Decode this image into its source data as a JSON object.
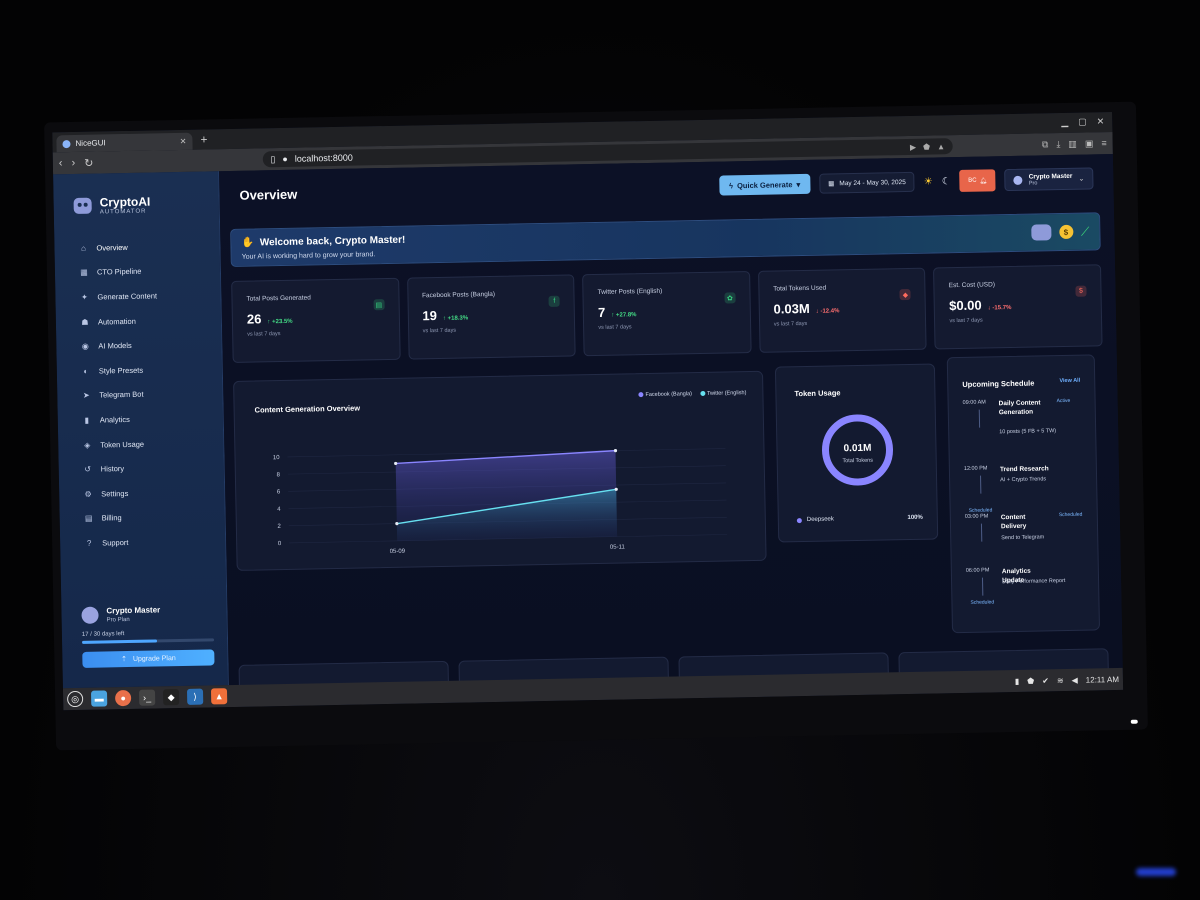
{
  "browser": {
    "tab_title": "NiceGUI",
    "url": "localhost:8000"
  },
  "sidebar": {
    "brand_name": "CryptoAI",
    "brand_sub": "AUTOMATOR",
    "items": [
      {
        "label": "Overview",
        "icon": "home-icon",
        "glyph": "⌂"
      },
      {
        "label": "CTO Pipeline",
        "icon": "pipeline-icon",
        "glyph": "▦"
      },
      {
        "label": "Generate Content",
        "icon": "sparkle-icon",
        "glyph": "✦"
      },
      {
        "label": "Automation",
        "icon": "robot-icon",
        "glyph": "☗"
      },
      {
        "label": "AI Models",
        "icon": "brain-icon",
        "glyph": "◉"
      },
      {
        "label": "Style Presets",
        "icon": "palette-icon",
        "glyph": "◐"
      },
      {
        "label": "Telegram Bot",
        "icon": "send-icon",
        "glyph": "➤"
      },
      {
        "label": "Analytics",
        "icon": "bar-chart-icon",
        "glyph": "▮"
      },
      {
        "label": "Token Usage",
        "icon": "token-icon",
        "glyph": "◈"
      },
      {
        "label": "History",
        "icon": "history-icon",
        "glyph": "↺"
      },
      {
        "label": "Settings",
        "icon": "gear-icon",
        "glyph": "⚙"
      },
      {
        "label": "Billing",
        "icon": "billing-icon",
        "glyph": "▤"
      },
      {
        "label": "Support",
        "icon": "help-icon",
        "glyph": "?"
      }
    ],
    "user": {
      "name": "Crypto Master",
      "plan": "Pro Plan",
      "days_left": "17 / 30 days left",
      "days_progress": 0.57,
      "upgrade_label": "Upgrade Plan"
    }
  },
  "header": {
    "title": "Overview",
    "quick_generate": "Quick Generate",
    "date_range": "May 24 - May 30, 2025",
    "notif_badge": "BC",
    "profile_name": "Crypto Master",
    "profile_plan": "Pro"
  },
  "welcome": {
    "title": "Welcome back, Crypto Master!",
    "subtitle": "Your AI is working hard to grow your brand."
  },
  "stats": [
    {
      "label": "Total Posts Generated",
      "value": "26",
      "change": "↑ +23.5%",
      "dir": "up",
      "sub": "vs last 7 days",
      "icon": "document-icon",
      "glyph": "▤",
      "color": "#35d07f"
    },
    {
      "label": "Facebook Posts (Bangla)",
      "value": "19",
      "change": "↑ +18.3%",
      "dir": "up",
      "sub": "vs last 7 days",
      "icon": "facebook-icon",
      "glyph": "f",
      "color": "#35d07f"
    },
    {
      "label": "Twitter Posts (English)",
      "value": "7",
      "change": "↑ +27.8%",
      "dir": "up",
      "sub": "vs last 7 days",
      "icon": "twitter-icon",
      "glyph": "✿",
      "color": "#35d07f"
    },
    {
      "label": "Total Tokens Used",
      "value": "0.03M",
      "change": "↓ -12.4%",
      "dir": "down",
      "sub": "vs last 7 days",
      "icon": "layers-icon",
      "glyph": "◆",
      "color": "#ff6b5e"
    },
    {
      "label": "Est. Cost (USD)",
      "value": "$0.00",
      "change": "↓ -15.7%",
      "dir": "down",
      "sub": "vs last 7 days",
      "icon": "dollar-icon",
      "glyph": "$",
      "color": "#ff6b5e"
    }
  ],
  "chart_data": {
    "type": "area",
    "title": "Content Generation Overview",
    "x": [
      "05-09",
      "05-11"
    ],
    "ylim": [
      0,
      10
    ],
    "yticks": [
      0,
      2,
      4,
      6,
      8,
      10
    ],
    "series": [
      {
        "name": "Facebook (Bangla)",
        "values": [
          9,
          10
        ],
        "color": "#8a85ff"
      },
      {
        "name": "Twitter (English)",
        "values": [
          2,
          5.5
        ],
        "color": "#67e0f0"
      }
    ],
    "legend": "top-right",
    "grid": true
  },
  "token_usage": {
    "title": "Token Usage",
    "total_value": "0.01M",
    "total_label": "Total Tokens",
    "model": "Deepseek",
    "model_share": 1.0,
    "model_pct": "100%",
    "ring_color": "#8a85ff"
  },
  "schedule": {
    "title": "Upcoming Schedule",
    "view_all": "View All",
    "items": [
      {
        "time": "09:00 AM",
        "title": "Daily Content Generation",
        "desc": "10 posts (5 FB + 5 TW)",
        "status": "Active"
      },
      {
        "time": "12:00 PM",
        "title": "Trend Research",
        "desc": "AI + Crypto Trends",
        "status": "Scheduled"
      },
      {
        "time": "03:00 PM",
        "title": "Content Delivery",
        "desc": "Send to Telegram",
        "status": "Scheduled"
      },
      {
        "time": "06:00 PM",
        "title": "Analytics Update",
        "desc": "Daily Performance Report",
        "status": "Scheduled"
      }
    ]
  },
  "taskbar": {
    "clock": "12:11 AM"
  }
}
